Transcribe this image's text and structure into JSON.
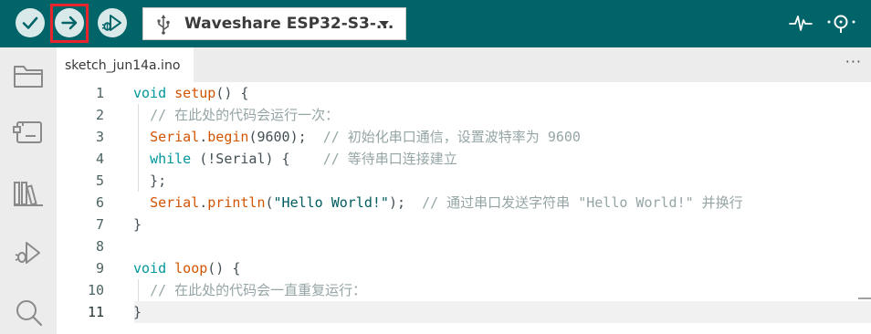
{
  "toolbar": {
    "verify_icon": "check-icon",
    "upload_icon": "arrow-right-icon",
    "debug_icon": "debug-play-icon",
    "board_icon": "usb-icon",
    "board_label": "Waveshare ESP32-S3-...",
    "serial_plotter_icon": "pulse-icon",
    "serial_monitor_icon": "magnifier-icon",
    "accent": "#006468",
    "highlight_color": "#e8242c"
  },
  "sidebar": {
    "items": [
      {
        "icon": "folder-icon"
      },
      {
        "icon": "board-manager-icon"
      },
      {
        "icon": "library-icon"
      },
      {
        "icon": "debug-icon"
      },
      {
        "icon": "search-icon"
      }
    ]
  },
  "tabs": {
    "active_label": "sketch_jun14a.ino",
    "more_label": "···"
  },
  "editor": {
    "current_line": 11,
    "lines": [
      {
        "num": "1",
        "tokens": [
          {
            "t": "void",
            "c": "kw"
          },
          {
            "t": " "
          },
          {
            "t": "setup",
            "c": "fn"
          },
          {
            "t": "() {"
          }
        ]
      },
      {
        "num": "2",
        "tokens": [
          {
            "t": "  "
          },
          {
            "t": "// 在此处的代码会运行一次：",
            "c": "cm"
          }
        ]
      },
      {
        "num": "3",
        "tokens": [
          {
            "t": "  "
          },
          {
            "t": "Serial",
            "c": "fn"
          },
          {
            "t": "."
          },
          {
            "t": "begin",
            "c": "fn"
          },
          {
            "t": "(9600);  "
          },
          {
            "t": "// 初始化串口通信，设置波特率为 9600",
            "c": "cm"
          }
        ]
      },
      {
        "num": "4",
        "tokens": [
          {
            "t": "  "
          },
          {
            "t": "while",
            "c": "kw"
          },
          {
            "t": " (!Serial) {    "
          },
          {
            "t": "// 等待串口连接建立",
            "c": "cm"
          }
        ]
      },
      {
        "num": "5",
        "tokens": [
          {
            "t": "  };"
          }
        ]
      },
      {
        "num": "6",
        "tokens": [
          {
            "t": "  "
          },
          {
            "t": "Serial",
            "c": "fn"
          },
          {
            "t": "."
          },
          {
            "t": "println",
            "c": "fn"
          },
          {
            "t": "("
          },
          {
            "t": "\"Hello World!\"",
            "c": "str"
          },
          {
            "t": ");  "
          },
          {
            "t": "// 通过串口发送字符串 \"Hello World!\" 并换行",
            "c": "cm"
          }
        ]
      },
      {
        "num": "7",
        "tokens": [
          {
            "t": "}"
          }
        ]
      },
      {
        "num": "8",
        "tokens": []
      },
      {
        "num": "9",
        "tokens": [
          {
            "t": "void",
            "c": "kw"
          },
          {
            "t": " "
          },
          {
            "t": "loop",
            "c": "fn"
          },
          {
            "t": "() {"
          }
        ]
      },
      {
        "num": "10",
        "tokens": [
          {
            "t": "  "
          },
          {
            "t": "// 在此处的代码会一直重复运行：",
            "c": "cm"
          }
        ]
      },
      {
        "num": "11",
        "tokens": [
          {
            "t": "}"
          }
        ]
      }
    ]
  }
}
